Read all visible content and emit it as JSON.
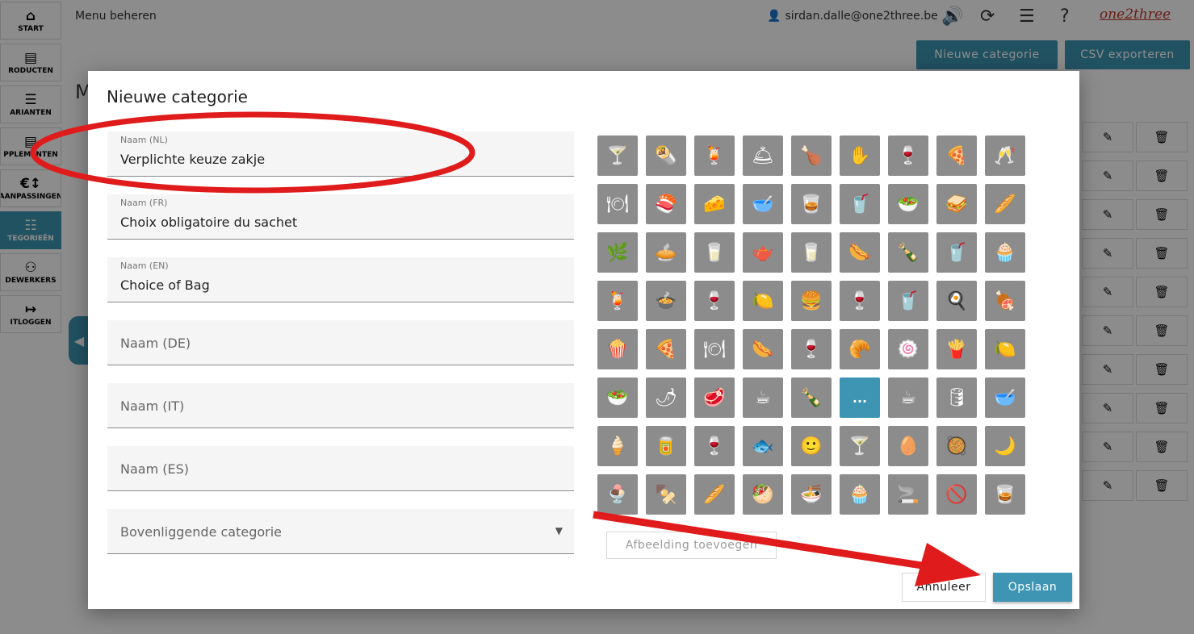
{
  "header": {
    "title": "Menu beheren",
    "user_email": "sirdan.dalle@one2three.be",
    "logo_text": "one2three",
    "buttons": {
      "new_category": "Nieuwe categorie",
      "export_csv": "CSV exporteren"
    }
  },
  "page": {
    "heading_partial": "M"
  },
  "sidebar": {
    "items": [
      {
        "label": "START",
        "icon": "⌂"
      },
      {
        "label": "RODUCTEN",
        "icon": "▤"
      },
      {
        "label": "ARIANTEN",
        "icon": "☰"
      },
      {
        "label": "PPLEMENTEN",
        "icon": "▤"
      },
      {
        "label": "AANPASSINGEN",
        "icon": "€↕"
      },
      {
        "label": "TEGORIEËN",
        "icon": "☷"
      },
      {
        "label": "DEWERKERS",
        "icon": "⚇"
      },
      {
        "label": "ITLOGGEN",
        "icon": "↦"
      }
    ]
  },
  "modal": {
    "title": "Nieuwe categorie",
    "fields": [
      {
        "label": "Naam (NL)",
        "value": "Verplichte keuze zakje"
      },
      {
        "label": "Naam (FR)",
        "value": "Choix obligatoire du sachet"
      },
      {
        "label": "Naam (EN)",
        "value": "Choice of Bag"
      },
      {
        "placeholder": "Naam (DE)"
      },
      {
        "placeholder": "Naam (IT)"
      },
      {
        "placeholder": "Naam (ES)"
      },
      {
        "placeholder": "Bovenliggende categorie"
      }
    ],
    "selected_icon_label": "...",
    "add_image": "Afbeelding toevoegen",
    "cancel": "Annuleer",
    "save": "Opslaan"
  },
  "icons": [
    "🍸",
    "🌯",
    "🍹",
    "🛎",
    "🍗",
    "✋",
    "🍷",
    "🍕",
    "🥂",
    "🍽",
    "🍣",
    "🧀",
    "🥣",
    "🥃",
    "🥤",
    "🥗",
    "🥪",
    "🥖",
    "🌿",
    "🥧",
    "🥛",
    "🫖",
    "🥛",
    "🌭",
    "🍾",
    "🥤",
    "🧁",
    "🍹",
    "🍲",
    "🍷",
    "🍋",
    "🍔",
    "🍷",
    "🥤",
    "🍳",
    "🍖",
    "🍿",
    "🍕",
    "🍽",
    "🌭",
    "🍷",
    "🥐",
    "🍥",
    "🍟",
    "🍋",
    "🥗",
    "🌶",
    "🥩",
    "☕",
    "🍾",
    "...",
    "☕",
    "🛢",
    "🥣",
    "🍦",
    "🥫",
    "🍷",
    "🐟",
    "🙂",
    "🍸",
    "🥚",
    "🥘",
    "🌙",
    "🍨",
    "🍢",
    "🥖",
    "🥙",
    "🍜",
    "🧁",
    "🚬",
    "🚫",
    "🥃"
  ],
  "colors": {
    "accent": "#3d95b3",
    "tile": "#8c8c8c",
    "annotation": "#e01b1b"
  }
}
